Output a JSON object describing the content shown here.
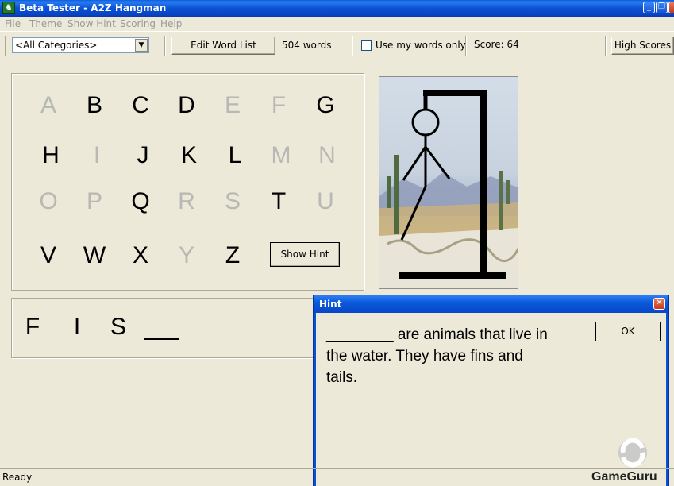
{
  "window": {
    "title": "Beta Tester - A2Z Hangman"
  },
  "menu": [
    "File",
    "Theme",
    "Show Hint",
    "Scoring",
    "Help"
  ],
  "toolbar": {
    "category_selected": "<All Categories>",
    "edit_word_list_label": "Edit Word List",
    "word_count": "504 words",
    "use_my_words_label": "Use my words only",
    "use_my_words_checked": false,
    "score": "Score: 64",
    "high_scores_label": "High Scores"
  },
  "letters": [
    {
      "char": "A",
      "used": true
    },
    {
      "char": "B",
      "used": false
    },
    {
      "char": "C",
      "used": false
    },
    {
      "char": "D",
      "used": false
    },
    {
      "char": "E",
      "used": true
    },
    {
      "char": "F",
      "used": true
    },
    {
      "char": "G",
      "used": false
    },
    {
      "char": "H",
      "used": false
    },
    {
      "char": "I",
      "used": true
    },
    {
      "char": "J",
      "used": false
    },
    {
      "char": "K",
      "used": false
    },
    {
      "char": "L",
      "used": false
    },
    {
      "char": "M",
      "used": true
    },
    {
      "char": "N",
      "used": true
    },
    {
      "char": "O",
      "used": true
    },
    {
      "char": "P",
      "used": true
    },
    {
      "char": "Q",
      "used": false
    },
    {
      "char": "R",
      "used": true
    },
    {
      "char": "S",
      "used": true
    },
    {
      "char": "T",
      "used": false
    },
    {
      "char": "U",
      "used": true
    },
    {
      "char": "V",
      "used": false
    },
    {
      "char": "W",
      "used": false
    },
    {
      "char": "X",
      "used": false
    },
    {
      "char": "Y",
      "used": true
    },
    {
      "char": "Z",
      "used": false
    }
  ],
  "show_hint_label": "Show Hint",
  "word": [
    "F",
    "I",
    "S",
    ""
  ],
  "hint_dialog": {
    "title": "Hint",
    "text": "________ are animals that live in the water. They have fins and tails.",
    "ok_label": "OK"
  },
  "status": "Ready",
  "watermark": "GameGuru",
  "colors": {
    "title_blue": "#0a52d4",
    "used_letter": "#b8b8b4",
    "face": "#ece9d8"
  }
}
